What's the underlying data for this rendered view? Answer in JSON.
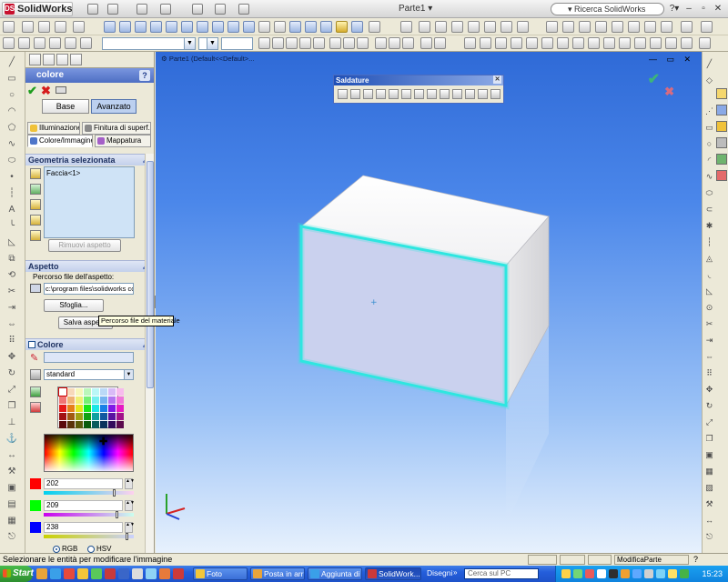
{
  "app": {
    "logo_text": "SolidWorks",
    "document_title": "Parte1 ▾",
    "search_placeholder": "▾ Ricerca SolidWorks"
  },
  "panel": {
    "title": "colore",
    "help": "?",
    "mode_buttons": [
      "Base",
      "Avanzato"
    ],
    "active_mode": "Avanzato",
    "tabs": {
      "illumination": "Illuminazione",
      "surface": "Finitura di superf...",
      "color_image": "Colore/Immagine",
      "mapping": "Mappatura"
    },
    "geometry": {
      "title": "Geometria selezionata",
      "items": [
        "Faccia<1>"
      ],
      "remove_button": "Rimuovi aspetto"
    },
    "appearance": {
      "title": "Aspetto",
      "path_label": "Percorso file dell'aspetto:",
      "path_value": "c:\\program files\\solidworks corp",
      "browse_button": "Sfoglia...",
      "save_button": "Salva aspetto",
      "tooltip": "Percorso file del materiale"
    },
    "color": {
      "title": "Colore",
      "palette_select": "standard",
      "channels": [
        {
          "name": "R",
          "value": "202",
          "level": 0.79,
          "color": "#ff0000"
        },
        {
          "name": "G",
          "value": "209",
          "level": 0.82,
          "color": "#00ff00"
        },
        {
          "name": "B",
          "value": "238",
          "level": 0.93,
          "color": "#0000ff"
        }
      ],
      "model_options": [
        "RGB",
        "HSV"
      ],
      "selected_model": "RGB"
    }
  },
  "viewport": {
    "tree_item": "Parte1  (Default<<Default>...",
    "weld_toolbar_title": "Saldature",
    "selected_face_color": "#cad1ee",
    "highlight_color": "#2ee6e0"
  },
  "status": {
    "message": "Selezionare le entità per modificare l'immagine",
    "mode": "ModificaParte"
  },
  "taskbar": {
    "start": "Start",
    "tasks": [
      "Foto",
      "Posta in arri...",
      "Aggiunta di ...",
      "SolidWork...",
      "Disegni"
    ],
    "active_task": "SolidWork...",
    "search_placeholder": "Cerca sul PC",
    "clock": "15:23"
  }
}
